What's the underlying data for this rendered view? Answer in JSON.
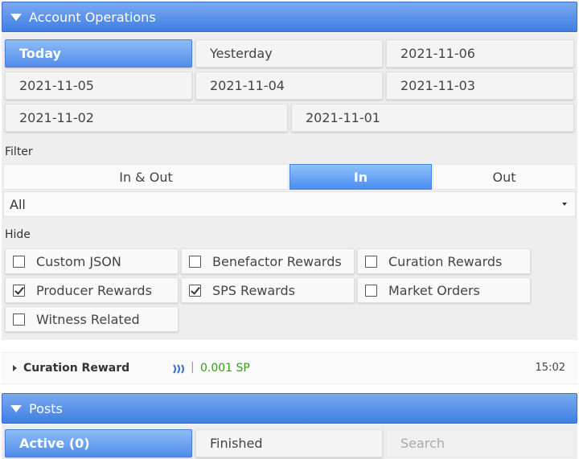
{
  "account_ops": {
    "title": "Account Operations",
    "dates": [
      "Today",
      "Yesterday",
      "2021-11-06",
      "2021-11-05",
      "2021-11-04",
      "2021-11-03",
      "2021-11-02",
      "2021-11-01"
    ],
    "filter_label": "Filter",
    "filter_options": [
      "In & Out",
      "In",
      "Out"
    ],
    "active_filter": "In",
    "type_select": "All",
    "hide_label": "Hide",
    "hide_options": [
      {
        "label": "Custom JSON",
        "checked": false
      },
      {
        "label": "Benefactor Rewards",
        "checked": false
      },
      {
        "label": "Curation Rewards",
        "checked": false
      },
      {
        "label": "Producer Rewards",
        "checked": true
      },
      {
        "label": "SPS Rewards",
        "checked": true
      },
      {
        "label": "Market Orders",
        "checked": false
      },
      {
        "label": "Witness Related",
        "checked": false
      }
    ]
  },
  "operation": {
    "type": "Curation Reward",
    "separator": "|",
    "amount": "0.001 SP",
    "time": "15:02",
    "icon": "steem-icon",
    "amount_color": "#3a9a1a"
  },
  "posts": {
    "title": "Posts",
    "tabs": [
      "Active (0)",
      "Finished"
    ],
    "search_placeholder": "Search"
  },
  "colors": {
    "accent": "#4a86e6",
    "panel": "#eeeeee"
  }
}
